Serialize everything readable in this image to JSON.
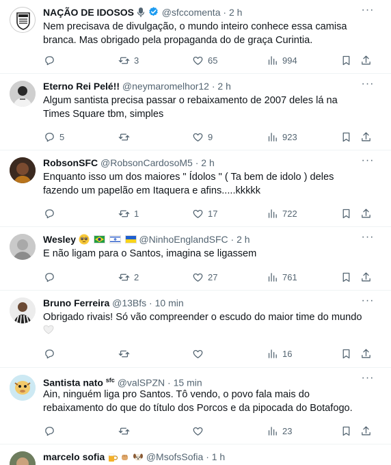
{
  "colors": {
    "text": "#0f1419",
    "muted": "#536471",
    "verified": "#1d9bf0",
    "divider": "#eff3f4"
  },
  "tweets": [
    {
      "name": "NAÇÃO DE IDOSOS",
      "name_icon": "microphone-icon",
      "verified": true,
      "handle": "@sfccomenta",
      "time": "2 h",
      "text": "Nem precisava de divulgação, o mundo inteiro conhece essa camisa branca. Mas obrigado pela propaganda do de graça Curintia.",
      "replies": "",
      "retweets": "3",
      "likes": "65",
      "views": "994"
    },
    {
      "name": "Eterno Rei Pelé!!",
      "handle": "@neymaromelhor12",
      "time": "2 h",
      "text": "Algum santista precisa passar o rebaixamento de 2007 deles lá na Times Square tbm, simples",
      "replies": "5",
      "retweets": "",
      "likes": "9",
      "views": "923"
    },
    {
      "name": "RobsonSFC",
      "handle": "@RobsonCardosoM5",
      "time": "2 h",
      "text": "Enquanto isso um dos maiores \" Ídolos \" ( Ta bem de idolo ) deles fazendo um papelão em Itaquera e afins.....kkkkk",
      "replies": "",
      "retweets": "1",
      "likes": "17",
      "views": "722"
    },
    {
      "name": "Wesley",
      "name_icons": [
        "pleading-face-emoji",
        "brazil-flag",
        "israel-flag",
        "ukraine-flag"
      ],
      "handle": "@NinhoEnglandSFC",
      "time": "2 h",
      "text": "E não ligam para o Santos, imagina se ligassem",
      "replies": "",
      "retweets": "2",
      "likes": "27",
      "views": "761"
    },
    {
      "name": "Bruno Ferreira",
      "handle": "@13Bfs",
      "time": "10 min",
      "text": "Obrigado rivais! Só vão compreender o escudo do maior time do mundo",
      "text_icon": "white-heart-emoji",
      "replies": "",
      "retweets": "",
      "likes": "",
      "views": "16"
    },
    {
      "name": "Santista nato",
      "name_suffix": "sfc",
      "handle": "@valSPZN",
      "time": "15 min",
      "text": "Ain, ninguém liga pro Santos. Tô vendo, o povo fala mais do rebaixamento do que do título dos Porcos e da pipocada do Botafogo.",
      "replies": "",
      "retweets": "",
      "likes": "",
      "views": "23"
    },
    {
      "name": "marcelo sofia",
      "name_icons": [
        "beer-emoji",
        "fist-emoji",
        "dog-emoji"
      ],
      "handle": "@MsofsSofia",
      "time": "1 h"
    }
  ],
  "sep": "·",
  "more_label": "···"
}
